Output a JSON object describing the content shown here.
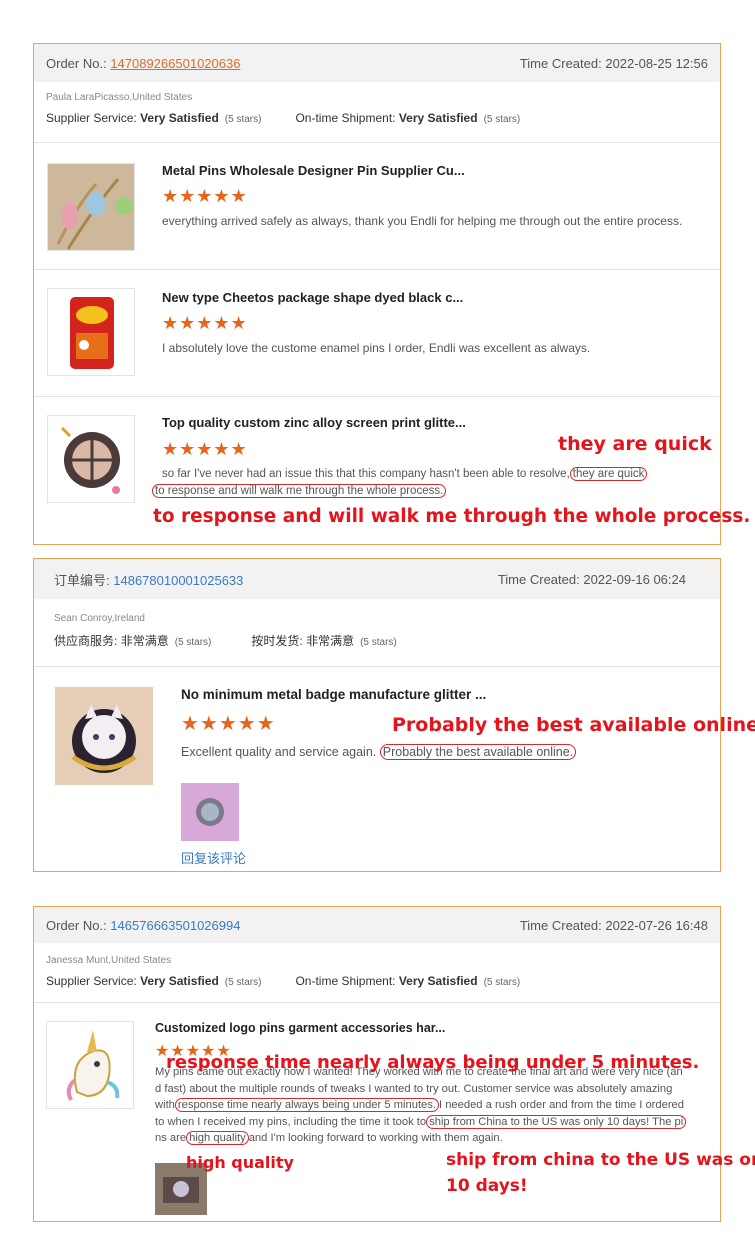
{
  "cards": [
    {
      "order_label": "Order No.:",
      "order_number": "147089266501020636",
      "time_label": "Time Created:",
      "time_value": "2022-08-25 12:56",
      "buyer": "Paula LaraPicasso,United States",
      "supplier_label": "Supplier Service:",
      "supplier_value": "Very Satisfied",
      "supplier_stars": "(5 stars)",
      "shipment_label": "On-time Shipment:",
      "shipment_value": "Very Satisfied",
      "shipment_stars": "(5 stars)",
      "items": [
        {
          "title": "Metal Pins Wholesale Designer Pin Supplier Cu...",
          "stars": "★★★★★",
          "review": "everything arrived safely as always, thank you Endli for helping me through out the entire process."
        },
        {
          "title": "New type Cheetos package shape dyed black c...",
          "stars": "★★★★★",
          "review": "I absolutely love the custome enamel pins I order, Endli was excellent as always."
        },
        {
          "title": "Top quality custom zinc alloy screen print glitte...",
          "stars": "★★★★★",
          "review_a": "so far I've never had an issue this that this company hasn't been able to resolve,",
          "review_circ1": "they are quick",
          "review_circ2": "to response  and will walk me through the whole process."
        }
      ],
      "annotation_1": "they are quick",
      "annotation_2": "to response and will walk me through the whole process."
    },
    {
      "order_label": "订单编号:",
      "order_number": "148678010001025633",
      "time_label": "Time Created:",
      "time_value": "2022-09-16 06:24",
      "buyer": "Sean Conroy,Ireland",
      "supplier_label": "供应商服务:",
      "supplier_value": "非常满意",
      "supplier_stars": "(5 stars)",
      "shipment_label": "按时发货:",
      "shipment_value": "非常满意",
      "shipment_stars": "(5 stars)",
      "items": [
        {
          "title": "No minimum metal badge manufacture glitter ...",
          "stars": "★★★★★",
          "review_a": "Excellent quality and service again.",
          "review_circ1": "Probably the best available online."
        }
      ],
      "annotation_1": "Probably the best available online.",
      "reply_link": "回复该评论"
    },
    {
      "order_label": "Order No.:",
      "order_number": "146576663501026994",
      "time_label": "Time Created:",
      "time_value": "2022-07-26 16:48",
      "buyer": "Janessa Munt,United States",
      "supplier_label": "Supplier Service:",
      "supplier_value": "Very Satisfied",
      "supplier_stars": "(5 stars)",
      "shipment_label": "On-time Shipment:",
      "shipment_value": "Very Satisfied",
      "shipment_stars": "(5 stars)",
      "items": [
        {
          "title": "Customized logo pins garment accessories har...",
          "stars": "★★★★★",
          "line1": "My pins came out exactly how I wanted! They worked with me to create the final art and were very nice (an",
          "line2": "d fast) about the multiple rounds of tweaks I wanted to try out. Customer service was absolutely amazing",
          "line3_a": "with",
          "line3_circ": "response time nearly always being under 5 minutes.",
          "line3_b": "I needed a rush order and from the time I ordered",
          "line4_a": "to when I received my pins, including the time it took to",
          "line4_circ": "ship from China to the US was only 10 days! The pi",
          "line5_a": "ns are",
          "line5_circ": "high quality",
          "line5_b": "and I'm looking forward to working with them again."
        }
      ],
      "annotation_1": "response time nearly always being under 5 minutes.",
      "annotation_2": "high quality",
      "annotation_3": "ship from china to the US was only",
      "annotation_4": "10 days!"
    }
  ]
}
